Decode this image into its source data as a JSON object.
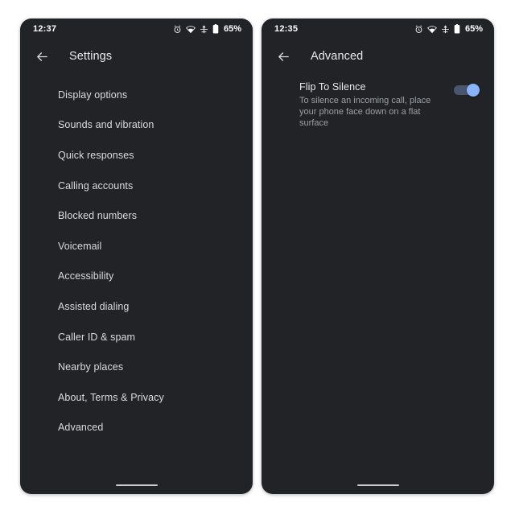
{
  "page": {
    "background_color": "#ffffff",
    "phone_background_color": "#212327",
    "accent_color": "#8ab4f8"
  },
  "left_phone": {
    "status_bar": {
      "time": "12:37",
      "icons": [
        "alarm-icon",
        "wifi-icon",
        "airplane-mode-icon",
        "battery-icon"
      ],
      "battery_percent": "65%"
    },
    "app_bar": {
      "back_icon": "arrow-back-icon",
      "title": "Settings"
    },
    "settings_items": [
      {
        "label": "Display options"
      },
      {
        "label": "Sounds and vibration"
      },
      {
        "label": "Quick responses"
      },
      {
        "label": "Calling accounts"
      },
      {
        "label": "Blocked numbers"
      },
      {
        "label": "Voicemail"
      },
      {
        "label": "Accessibility"
      },
      {
        "label": "Assisted dialing"
      },
      {
        "label": "Caller ID & spam"
      },
      {
        "label": "Nearby places"
      },
      {
        "label": "About, Terms & Privacy"
      },
      {
        "label": "Advanced"
      }
    ],
    "nav_bar": {
      "home_indicator": "home-indicator"
    }
  },
  "right_phone": {
    "status_bar": {
      "time": "12:35",
      "icons": [
        "alarm-icon",
        "wifi-icon",
        "airplane-mode-icon",
        "battery-icon"
      ],
      "battery_percent": "65%"
    },
    "app_bar": {
      "back_icon": "arrow-back-icon",
      "title": "Advanced"
    },
    "preference": {
      "title": "Flip To Silence",
      "summary": "To silence an incoming call, place your phone face down on a flat surface",
      "toggle_state": "on"
    },
    "nav_bar": {
      "home_indicator": "home-indicator"
    }
  }
}
